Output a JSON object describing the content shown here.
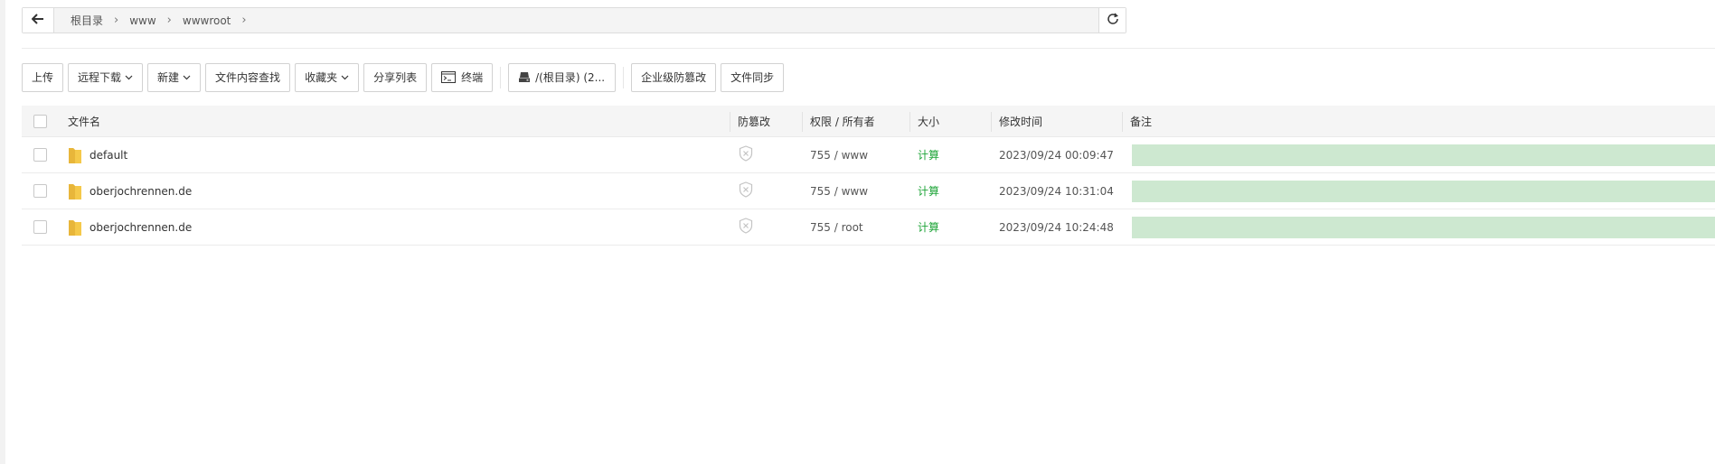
{
  "breadcrumb": {
    "items": [
      "根目录",
      "www",
      "wwwroot"
    ]
  },
  "toolbar": {
    "upload": "上传",
    "remote_download": "远程下载",
    "new": "新建",
    "content_search": "文件内容查找",
    "favorites": "收藏夹",
    "share_list": "分享列表",
    "terminal": "终端",
    "disk": "/(根目录) (2...",
    "tamper_proof": "企业级防篡改",
    "file_sync": "文件同步"
  },
  "table": {
    "headers": {
      "name": "文件名",
      "tamper": "防篡改",
      "perm": "权限 / 所有者",
      "size": "大小",
      "mtime": "修改时间",
      "note": "备注"
    },
    "rows": [
      {
        "name": "default",
        "perm": "755 / www",
        "size": "计算",
        "mtime": "2023/09/24 00:09:47"
      },
      {
        "name": "oberjochrennen.de",
        "perm": "755 / www",
        "size": "计算",
        "mtime": "2023/09/24 10:31:04"
      },
      {
        "name": "oberjochrennen.de",
        "perm": "755 / root",
        "size": "计算",
        "mtime": "2023/09/24 10:24:48"
      }
    ]
  },
  "icons": {
    "back": "arrow-left-icon",
    "refresh": "refresh-icon",
    "folder": "folder-icon",
    "shield": "shield-icon",
    "terminal": "terminal-icon",
    "disk": "disk-icon"
  },
  "colors": {
    "accent_green": "#20a53a",
    "note_bar": "#cde8d0",
    "folder": "#f5c94a"
  }
}
